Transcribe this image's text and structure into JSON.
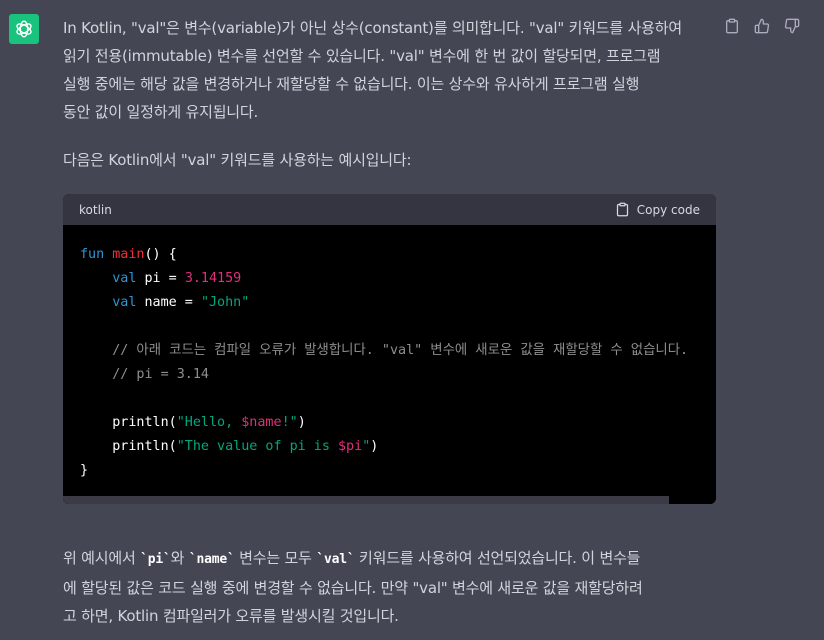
{
  "message": {
    "para1_lines": [
      "In Kotlin, \"val\"은 변수(variable)가 아닌 상수(constant)를 의미합니다. \"val\" 키워드를 사용하여",
      "읽기 전용(immutable) 변수를 선언할 수 있습니다. \"val\" 변수에 한 번 값이 할당되면, 프로그램",
      "실행 중에는 해당 값을 변경하거나 재할당할 수 없습니다. 이는 상수와 유사하게 프로그램 실행",
      "동안 값이 일정하게 유지됩니다."
    ],
    "para2": "다음은 Kotlin에서 \"val\" 키워드를 사용하는 예시입니다:",
    "para3": {
      "line1_prefix": "위 예시에서 ",
      "code1": "`pi`",
      "line1_mid1": "와 ",
      "code2": "`name`",
      "line1_mid2": " 변수는 모두 ",
      "code3": "`val`",
      "line1_suffix": " 키워드를 사용하여 선언되었습니다. 이 변수들",
      "line2": "에 할당된 값은 코드 실행 중에 변경할 수 없습니다. 만약 \"val\" 변수에 새로운 값을 재할당하려",
      "line3": "고 하면, Kotlin 컴파일러가 오류를 발생시킬 것입니다."
    }
  },
  "codeblock": {
    "language": "kotlin",
    "copy_label": "Copy code",
    "lines": [
      [
        {
          "t": "fun",
          "c": "kw"
        },
        {
          "t": " "
        },
        {
          "t": "main",
          "c": "fn"
        },
        {
          "t": "() {"
        }
      ],
      [
        {
          "t": "    "
        },
        {
          "t": "val",
          "c": "kw"
        },
        {
          "t": " pi = "
        },
        {
          "t": "3.14159",
          "c": "num"
        }
      ],
      [
        {
          "t": "    "
        },
        {
          "t": "val",
          "c": "kw"
        },
        {
          "t": " name = "
        },
        {
          "t": "\"John\"",
          "c": "str"
        }
      ],
      [],
      [
        {
          "t": "    "
        },
        {
          "t": "// 아래 코드는 컴파일 오류가 발생합니다. \"val\" 변수에 새로운 값을 재할당할 수 없습니다.",
          "c": "cm"
        }
      ],
      [
        {
          "t": "    "
        },
        {
          "t": "// pi = 3.14",
          "c": "cm"
        }
      ],
      [],
      [
        {
          "t": "    println("
        },
        {
          "t": "\"Hello, ",
          "c": "str"
        },
        {
          "t": "$name",
          "c": "interp"
        },
        {
          "t": "!\"",
          "c": "str"
        },
        {
          "t": ")"
        }
      ],
      [
        {
          "t": "    println("
        },
        {
          "t": "\"The value of pi is ",
          "c": "str"
        },
        {
          "t": "$pi",
          "c": "interp"
        },
        {
          "t": "\"",
          "c": "str"
        },
        {
          "t": ")"
        }
      ],
      [
        {
          "t": "}"
        }
      ]
    ]
  },
  "icons": {
    "avatar": "chatgpt-logo-icon",
    "copy": "clipboard-icon",
    "like": "thumbs-up-icon",
    "dislike": "thumbs-down-icon"
  },
  "colors": {
    "background": "#444654",
    "avatar": "#19c37d",
    "code_bg": "#000000",
    "code_header": "#343541",
    "keyword": "#2e95d3",
    "function": "#f22c3d",
    "number": "#df3079",
    "string": "#00a67d",
    "comment": "#8e8e8e"
  }
}
